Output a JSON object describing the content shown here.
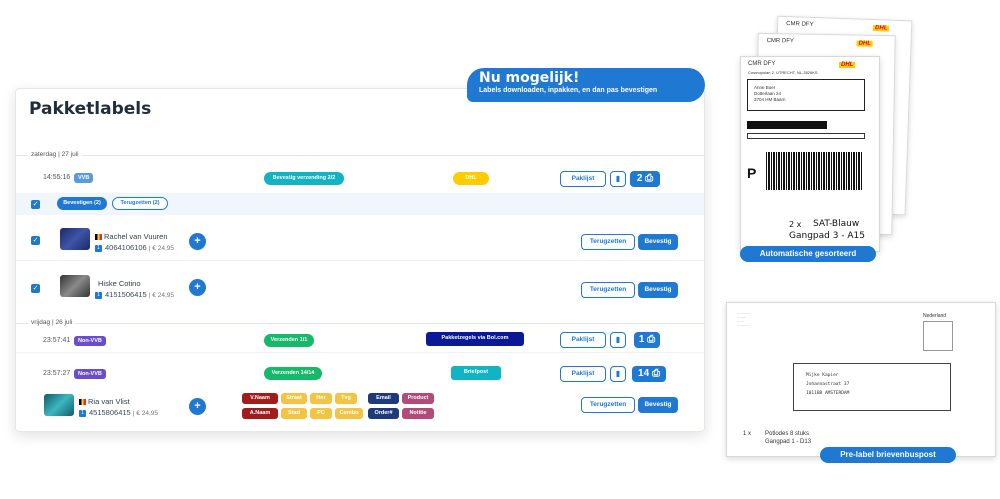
{
  "panel": {
    "title": "Pakketlabels"
  },
  "callout": {
    "title": "Nu mogelijk!",
    "subtitle": "Labels downloaden, inpakken, en dan pas bevestigen"
  },
  "groups": [
    {
      "date": "zaterdag | 27 juli"
    },
    {
      "date": "vrijdag | 26 juli"
    }
  ],
  "order1": {
    "time": "14:55:16",
    "tag": "VVB",
    "action": "Bevestig verzending 2/2",
    "carrier": "DHL",
    "paklijst": "Paklijst",
    "count": "2",
    "bulk_confirm": "Bevestigen (2)",
    "bulk_reset": "Terugzetten (2)",
    "items": [
      {
        "name": "Rachel van Vuuren",
        "ean": "4064106106",
        "price": "| € 24,95",
        "qty": "1",
        "reset": "Terugzetten",
        "confirm": "Bevestig"
      },
      {
        "name": "Hiske Cotino",
        "ean": "4151506415",
        "price": "| € 24,95",
        "qty": "1",
        "reset": "Terugzetten",
        "confirm": "Bevestig"
      }
    ]
  },
  "order2": {
    "time": "23:57:41",
    "tag": "Non-VVB",
    "action": "Verzenden 1/1",
    "carrier": "Pakketzegels via Bol.com",
    "paklijst": "Paklijst",
    "count": "1"
  },
  "order3": {
    "time": "23:57:27",
    "tag": "Non-VVB",
    "action": "Verzenden 14/14",
    "carrier": "Briefpost",
    "paklijst": "Paklijst",
    "count": "14",
    "item": {
      "name": "Ria van Vlist",
      "ean": "4515806415",
      "price": "| € 24,95",
      "qty": "1",
      "reset": "Terugzetten",
      "confirm": "Bevestig"
    },
    "variables": [
      "V.Naam",
      "Straat",
      "Hnr",
      "Tvg",
      "Email",
      "Product",
      "A.Naam",
      "Stad",
      "PC",
      "Combo",
      "Order#",
      "Notitie"
    ]
  },
  "dhl": {
    "header": "CMR DFY",
    "logo": "DHL",
    "addr": [
      "Anne Boer",
      "Dotterlaan 24",
      "3704 HM Baarn"
    ],
    "sender": "Cosmopolan 2, UTRECHT, NL-3526KS",
    "barcode_letter": "P",
    "pick_qty": "2 x",
    "pick_sku": "SAT-Blauw",
    "pick_loc": "Gangpad 3 - A15",
    "caption": "Automatische gesorteerd"
  },
  "letter": {
    "country": "Nederland",
    "name": "Mijke Kapier",
    "street": "Johannastraat 37",
    "city": "1011BB AMSTERDAM",
    "qty": "1 x",
    "product": "Potlodes 8 stuks",
    "location": "Gangpad 1 - D13",
    "caption": "Pre-label brievenbuspost"
  },
  "colors": {
    "primary": "#1f78d1",
    "teal": "#12b3c3",
    "green": "#16b86a",
    "dhl_yellow": "#ffcc00",
    "navy": "#0a1a96",
    "purple": "#6a4ccd"
  }
}
